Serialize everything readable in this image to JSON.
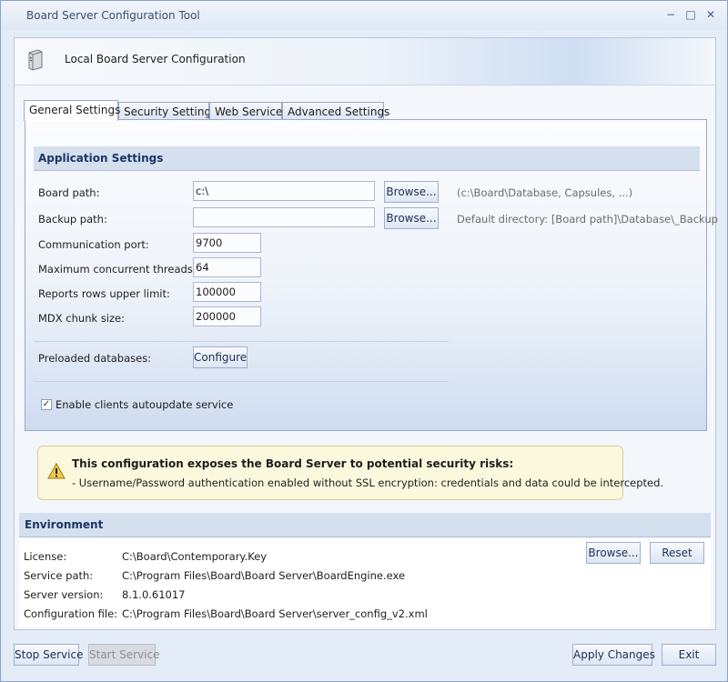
{
  "window": {
    "title": "Board Server Configuration Tool",
    "minimize": "−",
    "maximize": "□",
    "close": "✕"
  },
  "header": {
    "title": "Local Board Server Configuration"
  },
  "tabs": [
    {
      "label": "General Settings",
      "active": true
    },
    {
      "label": "Security Settings",
      "active": false
    },
    {
      "label": "Web Service",
      "active": false
    },
    {
      "label": "Advanced Settings",
      "active": false
    }
  ],
  "application_settings": {
    "section_title": "Application Settings",
    "board_path": {
      "label": "Board path:",
      "value": "c:\\",
      "browse": "Browse...",
      "hint": "(c:\\Board\\Database, Capsules, ...)"
    },
    "backup_path": {
      "label": "Backup path:",
      "value": "",
      "browse": "Browse...",
      "hint": "Default directory: [Board path]\\Database\\_Backup"
    },
    "communication_port": {
      "label": "Communication port:",
      "value": "9700"
    },
    "max_threads": {
      "label": "Maximum concurrent threads:",
      "value": "64"
    },
    "reports_rows": {
      "label": "Reports rows upper limit:",
      "value": "100000"
    },
    "mdx_chunk": {
      "label": "MDX chunk size:",
      "value": "200000"
    },
    "preloaded": {
      "label": "Preloaded databases:",
      "button": "Configure"
    },
    "autoupdate": {
      "label": "Enable clients autoupdate service",
      "checked": true,
      "check_glyph": "✓"
    }
  },
  "warning": {
    "title": "This configuration exposes the Board Server to potential security risks:",
    "detail": "- Username/Password authentication enabled without SSL encryption: credentials and data could be intercepted."
  },
  "environment": {
    "section_title": "Environment",
    "rows": [
      {
        "label": "License:",
        "value": "C:\\Board\\Contemporary.Key"
      },
      {
        "label": "Service path:",
        "value": "C:\\Program Files\\Board\\Board Server\\BoardEngine.exe"
      },
      {
        "label": "Server version:",
        "value": "8.1.0.61017"
      },
      {
        "label": "Configuration file:",
        "value": "C:\\Program Files\\Board\\Board Server\\server_config_v2.xml"
      }
    ],
    "browse": "Browse...",
    "reset": "Reset"
  },
  "footer": {
    "stop_service": "Stop Service",
    "start_service": "Start Service",
    "apply_changes": "Apply Changes",
    "exit": "Exit"
  }
}
